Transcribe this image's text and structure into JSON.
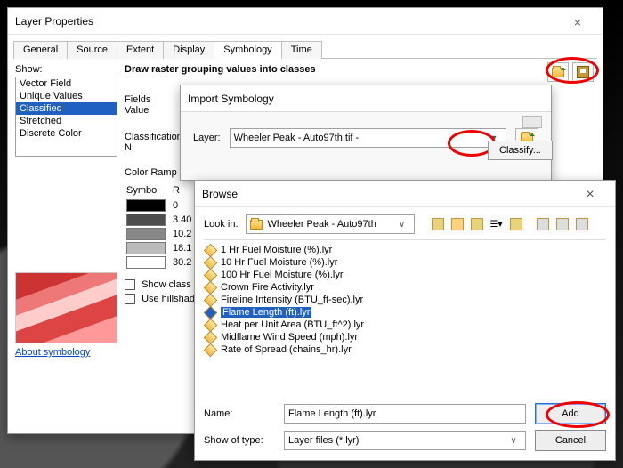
{
  "layerProperties": {
    "title": "Layer Properties",
    "closeX": "×",
    "tabs": [
      "General",
      "Source",
      "Extent",
      "Display",
      "Symbology",
      "Time"
    ],
    "activeTab": 4,
    "showLabel": "Show:",
    "showItems": [
      "Vector Field",
      "Unique Values",
      "Classified",
      "Stretched",
      "Discrete Color"
    ],
    "showSelectedIndex": 2,
    "sectionTitle": "Draw raster grouping values into classes",
    "fieldsLabel": "Fields",
    "valueLabel": "Value",
    "classificationLabel": "Classification",
    "nLabel": "N",
    "classifyButton": "Classify...",
    "colorRampLabel": "Color Ramp",
    "sym_header_symbol": "Symbol",
    "sym_header_range": "R",
    "sym_rows": [
      "0",
      "3.40",
      "10.2",
      "18.1",
      "30.2"
    ],
    "chk1": "Show class b",
    "chk2": "Use hillshade",
    "aboutLink": "About symbology"
  },
  "importSymbology": {
    "title": "Import Symbology",
    "layerLabel": "Layer:",
    "layerValue": "Wheeler Peak - Auto97th.tif - "
  },
  "browse": {
    "title": "Browse",
    "closeX": "×",
    "lookInLabel": "Look in:",
    "lookInValue": "Wheeler Peak - Auto97th",
    "files": [
      "1 Hr Fuel Moisture (%).lyr",
      "10 Hr Fuel Moisture (%).lyr",
      "100 Hr Fuel Moisture (%).lyr",
      "Crown Fire Activity.lyr",
      "Fireline Intensity (BTU_ft-sec).lyr",
      "Flame Length (ft).lyr",
      "Heat per Unit Area (BTU_ft^2).lyr",
      "Midflame Wind Speed (mph).lyr",
      "Rate of Spread (chains_hr).lyr"
    ],
    "selectedIndex": 5,
    "nameLabel": "Name:",
    "nameValue": "Flame Length (ft).lyr",
    "typeLabel": "Show of type:",
    "typeValue": "Layer files (*.lyr)",
    "addButton": "Add",
    "cancelButton": "Cancel"
  }
}
